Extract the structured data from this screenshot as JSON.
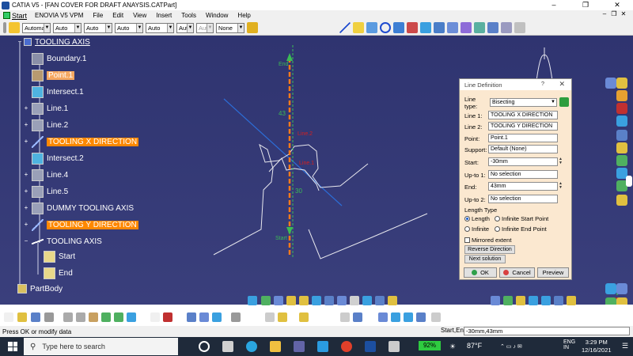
{
  "window": {
    "title": "CATIA V5 - [FAN COVER FOR DRAFT ANAYSIS.CATPart]",
    "controls": [
      "–",
      "❐",
      "✕"
    ]
  },
  "menu": {
    "items": [
      "Start",
      "ENOVIA V5 VPM",
      "File",
      "Edit",
      "View",
      "Insert",
      "Tools",
      "Window",
      "Help"
    ]
  },
  "toolbar": {
    "combos": [
      "Automa",
      "Auto",
      "Auto",
      "Auto",
      "Auto",
      "Aut",
      "Aut",
      "None"
    ]
  },
  "tree": {
    "root": "TOOLING AXIS",
    "items": [
      {
        "label": "Boundary.1",
        "icon": "boundary-icon"
      },
      {
        "label": "Point.1",
        "icon": "point-icon"
      },
      {
        "label": "Intersect.1",
        "icon": "intersect-icon"
      },
      {
        "label": "Line.1",
        "icon": "line-icon"
      },
      {
        "label": "Line.2",
        "icon": "line-icon"
      },
      {
        "label": "TOOLING X DIRECTION",
        "icon": "axis-line-icon"
      },
      {
        "label": "Intersect.2",
        "icon": "intersect-icon"
      },
      {
        "label": "Line.4",
        "icon": "line-icon"
      },
      {
        "label": "Line.5",
        "icon": "line-icon"
      },
      {
        "label": "DUMMY TOOLING AXIS",
        "icon": "line-icon"
      },
      {
        "label": "TOOLING Y DIRECTION",
        "icon": "axis-line-icon"
      },
      {
        "label": "TOOLING AXIS",
        "icon": "axis-line-icon"
      },
      {
        "label": "Start",
        "icon": "point-icon"
      },
      {
        "label": "End",
        "icon": "point-icon"
      },
      {
        "label": "PartBody",
        "icon": "body-icon"
      }
    ]
  },
  "viewport": {
    "labels": {
      "end": "End",
      "start": "Start",
      "dim_top": "43",
      "dim_bottom": "30",
      "line2": "Line.2",
      "line1": "Line.1"
    }
  },
  "dialog": {
    "title": "Line Definition",
    "help": "?",
    "close": "✕",
    "line_type_label": "Line type:",
    "line_type_value": "Bisecting",
    "line1_label": "Line 1:",
    "line1_value": "TOOLING X DIRECTION",
    "line2_label": "Line 2:",
    "line2_value": "TOOLING Y DIRECTION",
    "point_label": "Point:",
    "point_value": "Point.1",
    "support_label": "Support:",
    "support_value": "Default (None)",
    "start_label": "Start:",
    "start_value": "-30mm",
    "upto1_label": "Up-to 1:",
    "upto1_value": "No selection",
    "end_label": "End:",
    "end_value": "43mm",
    "upto2_label": "Up-to 2:",
    "upto2_value": "No selection",
    "length_type_label": "Length Type",
    "opt_length": "Length",
    "opt_inf_start": "Infinite Start Point",
    "opt_infinite": "Infinite",
    "opt_inf_end": "Infinite End Point",
    "mirrored": "Mirrored extent",
    "reverse": "Reverse Direction",
    "next": "Next solution",
    "ok": "OK",
    "cancel": "Cancel",
    "preview": "Preview"
  },
  "statusbar": {
    "message": "Press OK or modify data",
    "prompt_label": "Start,End",
    "prompt_value": "-30mm,43mm"
  },
  "taskbar": {
    "search_placeholder": "Type here to search",
    "battery": "92%",
    "weather": "87°F",
    "lang1": "ENG",
    "lang2": "IN",
    "time": "3:29 PM",
    "date": "12/16/2021"
  },
  "colors": {
    "viewport": "#343a76",
    "highlight": "#ff8800",
    "dialog_bg": "#fbe8d0"
  }
}
